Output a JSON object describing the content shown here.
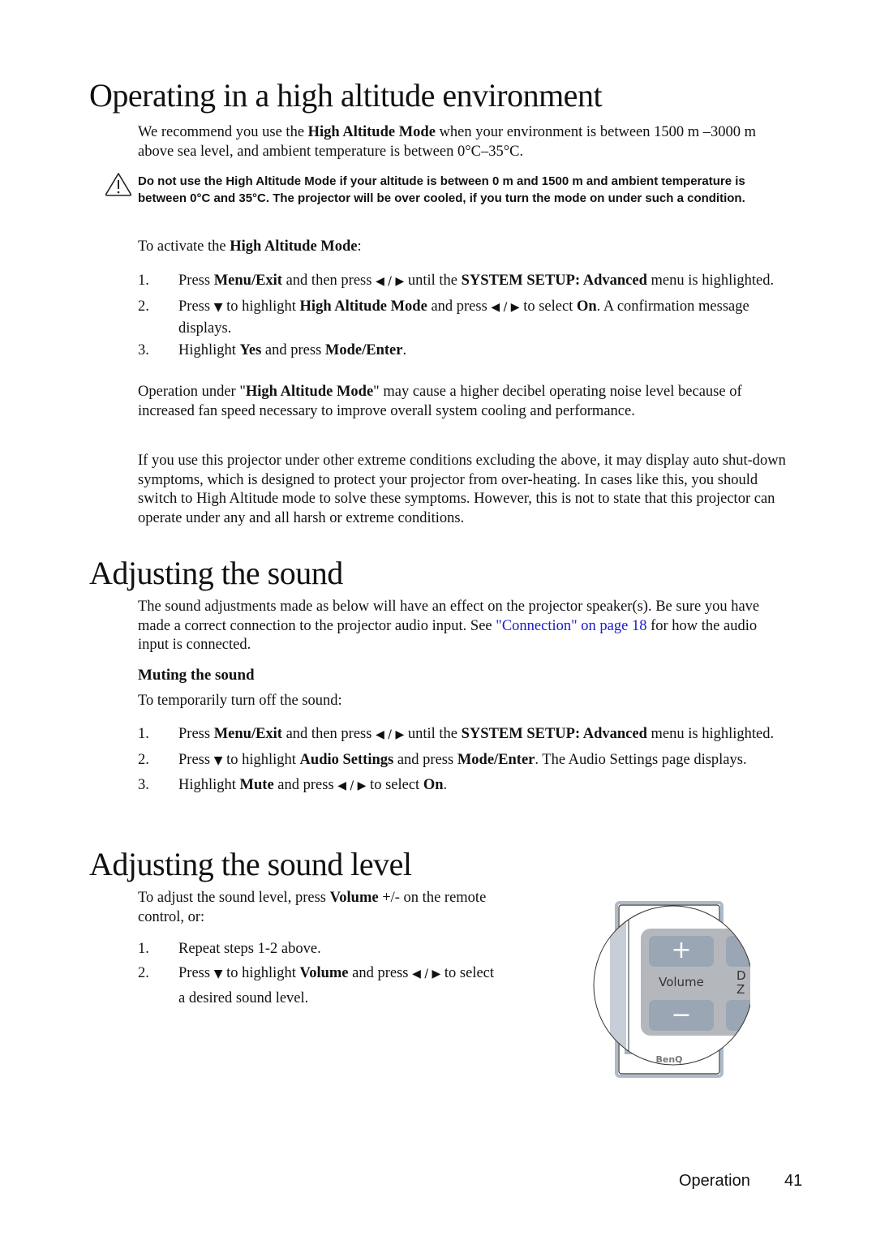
{
  "section1": {
    "title": "Operating in a high altitude environment",
    "intro": {
      "pre": "We recommend you use the ",
      "bold": "High Altitude Mode",
      "post": " when your environment is between 1500 m –3000 m above sea level, and ambient temperature is between 0°C–35°C."
    },
    "warning": {
      "icon": "warning-triangle-icon",
      "text": "Do not use the High Altitude Mode if your altitude is between 0 m and 1500 m and ambient temperature is between 0°C and 35°C. The projector will be over cooled, if you turn the mode on under such a condition."
    },
    "activate": {
      "pre": "To activate the ",
      "bold": "High Altitude Mode",
      "post": ":"
    },
    "steps": [
      {
        "num": "1.",
        "parts": [
          "Press ",
          "Menu/Exit",
          " and then press ",
          "◀ / ▶",
          " until the ",
          "SYSTEM SETUP: Advanced",
          " menu is highlighted."
        ]
      },
      {
        "num": "2.",
        "parts": [
          "Press ",
          "▼",
          " to highlight ",
          "High Altitude Mode",
          " and press ",
          "◀ / ▶",
          " to select ",
          "On",
          ". A confirmation message displays."
        ]
      },
      {
        "num": "3.",
        "parts": [
          "Highlight ",
          "Yes",
          " and press ",
          "Mode/Enter",
          "."
        ]
      }
    ],
    "noise_note": {
      "pre": "Operation under \"",
      "bold": "High Altitude Mode",
      "post": "\" may cause a higher decibel operating noise level because of increased fan speed necessary to improve overall system cooling and performance."
    },
    "extreme_note": "If you use this projector under other extreme conditions excluding the above, it may display auto shut-down symptoms, which is designed to protect your projector from over-heating. In cases like this, you should switch to High Altitude mode to solve these symptoms. However, this is not to state that this projector can operate under any and all harsh or extreme conditions."
  },
  "section2": {
    "title": "Adjusting the sound",
    "intro": {
      "pre": "The sound adjustments made as below will have an effect on the projector speaker(s). Be sure you have made a correct connection to the projector audio input. See ",
      "link": "\"Connection\" on page 18",
      "post": " for how the audio input is connected."
    },
    "subheading": "Muting the sound",
    "sub_intro": "To temporarily turn off the sound:",
    "steps": [
      {
        "num": "1.",
        "parts": [
          "Press ",
          "Menu/Exit",
          " and then press ",
          "◀ / ▶",
          " until the ",
          "SYSTEM SETUP: Advanced",
          " menu is highlighted."
        ]
      },
      {
        "num": "2.",
        "parts": [
          "Press ",
          "▼",
          " to highlight ",
          "Audio Settings",
          " and press ",
          "Mode/Enter",
          ". The Audio Settings page displays."
        ]
      },
      {
        "num": "3.",
        "parts": [
          "Highlight ",
          "Mute",
          " and press ",
          "◀ / ▶",
          " to select ",
          "On",
          "."
        ]
      }
    ]
  },
  "section3": {
    "title": "Adjusting the sound level",
    "intro": {
      "pre": "To adjust the sound level, press ",
      "bold": "Volume",
      "post": " +/- on the remote control, or:"
    },
    "steps": [
      {
        "num": "1.",
        "parts": [
          "Repeat steps 1-2 above."
        ]
      },
      {
        "num": "2.",
        "parts": [
          "Press ",
          "▼",
          " to highlight ",
          "Volume",
          " and press ",
          "◀ / ▶",
          " to select a desired sound level."
        ]
      }
    ],
    "remote_image": {
      "plus_label": "+",
      "volume_label": "Volume",
      "minus_label": "−",
      "partial_label_1": "D",
      "partial_label_2": "Z",
      "brand": "BenQ"
    }
  },
  "footer": {
    "section": "Operation",
    "page": "41"
  }
}
